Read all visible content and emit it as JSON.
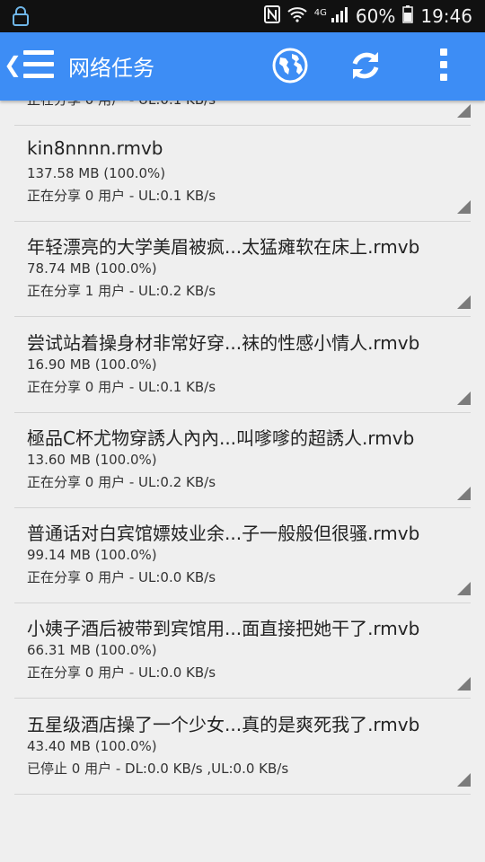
{
  "status_bar": {
    "network_label": "4G",
    "battery": "60%",
    "time": "19:46",
    "icons": [
      "lock-icon",
      "nfc-icon",
      "wifi-icon",
      "signal-icon",
      "battery-icon"
    ]
  },
  "app_bar": {
    "title": "网络任务",
    "accent_color": "#3d8df5",
    "icons": [
      "chevron-left-icon",
      "menu-icon",
      "globe-icon",
      "refresh-icon",
      "more-vert-icon"
    ]
  },
  "tasks": [
    {
      "name": "",
      "size": "",
      "status": "正在分享  0 用户 - UL:0.1 KB/s"
    },
    {
      "name": "kin8nnnn.rmvb",
      "size": "137.58 MB  (100.0%)",
      "status": "正在分享  0 用户 - UL:0.1 KB/s"
    },
    {
      "name": "年轻漂亮的大学美眉被疯...太猛瘫软在床上.rmvb",
      "size": "78.74 MB  (100.0%)",
      "status": "正在分享  1 用户 - UL:0.2 KB/s"
    },
    {
      "name": "尝试站着操身材非常好穿...袜的性感小情人.rmvb",
      "size": "16.90 MB  (100.0%)",
      "status": "正在分享  0 用户 - UL:0.1 KB/s"
    },
    {
      "name": "極品C杯尤物穿誘人內內...叫嗲嗲的超誘人.rmvb",
      "size": "13.60 MB  (100.0%)",
      "status": "正在分享  0 用户 - UL:0.2 KB/s"
    },
    {
      "name": "普通话对白宾馆嫖妓业余...子一般般但很骚.rmvb",
      "size": "99.14 MB  (100.0%)",
      "status": "正在分享  0 用户 - UL:0.0 KB/s"
    },
    {
      "name": "小姨子酒后被带到宾馆用...面直接把她干了.rmvb",
      "size": "66.31 MB  (100.0%)",
      "status": "正在分享  0 用户 - UL:0.0 KB/s"
    },
    {
      "name": "五星级酒店操了一个少女...真的是爽死我了.rmvb",
      "size": "43.40 MB  (100.0%)",
      "status": "已停止  0 用户 - DL:0.0 KB/s ,UL:0.0 KB/s"
    }
  ]
}
